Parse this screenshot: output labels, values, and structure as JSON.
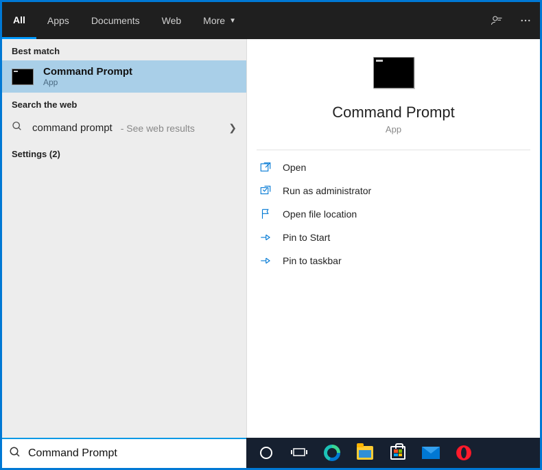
{
  "header": {
    "tabs": [
      "All",
      "Apps",
      "Documents",
      "Web",
      "More"
    ]
  },
  "left": {
    "best_match_label": "Best match",
    "best_match": {
      "title": "Command Prompt",
      "subtitle": "App"
    },
    "search_web_label": "Search the web",
    "web_result": {
      "query": "command prompt",
      "hint": " - See web results"
    },
    "settings_label": "Settings (2)"
  },
  "right": {
    "title": "Command Prompt",
    "subtitle": "App",
    "actions": {
      "open": "Open",
      "run_admin": "Run as administrator",
      "open_loc": "Open file location",
      "pin_start": "Pin to Start",
      "pin_taskbar": "Pin to taskbar"
    }
  },
  "search": {
    "value": "Command Prompt"
  }
}
